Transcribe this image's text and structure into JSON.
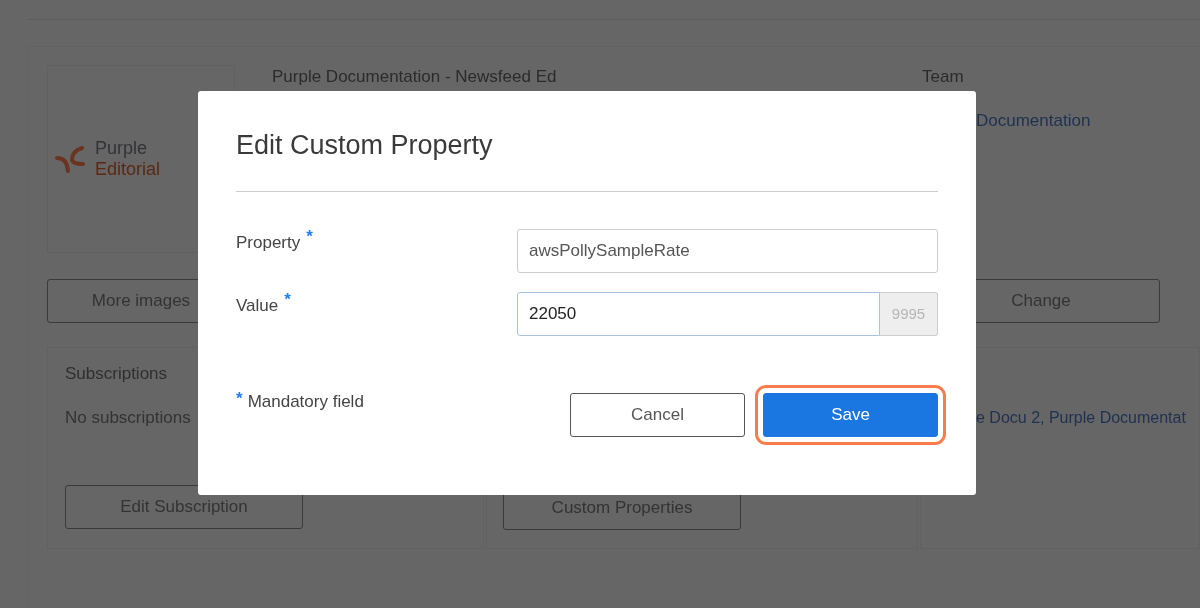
{
  "background_page": {
    "logo": {
      "line_1": "Purple",
      "line_2": "Editorial"
    },
    "more_images_button": "More images",
    "title": "Purple Documentation - Newsfeed Ed",
    "team": {
      "label": "Team",
      "link": "Documentation",
      "button": "Change"
    },
    "subscriptions_card": {
      "title": "Subscriptions",
      "text": "No subscriptions",
      "button": "Edit Subscription"
    },
    "properties_card": {
      "button": "Custom Properties"
    },
    "third_card": {
      "links": "e Docu 2, Purple Documentat"
    }
  },
  "dialog": {
    "title": "Edit Custom Property",
    "fields": [
      {
        "label": "Property",
        "required_mark": "*",
        "value": "awsPollySampleRate",
        "focused": false
      },
      {
        "label": "Value",
        "required_mark": "*",
        "value": "22050",
        "focused": true,
        "suffix": "9995"
      }
    ],
    "note": {
      "mark": "*",
      "text": "Mandatory field"
    },
    "buttons": [
      {
        "label": "Cancel",
        "kind": "secondary",
        "highlighted": false
      },
      {
        "label": "Save",
        "kind": "primary",
        "highlighted": true
      }
    ]
  }
}
